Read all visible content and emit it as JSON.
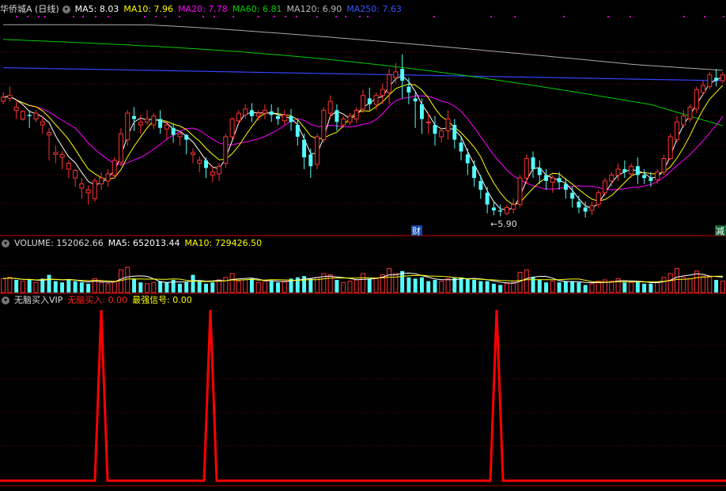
{
  "main_legend": {
    "title": "华侨城A (日线)",
    "ma5": "MA5: 8.03",
    "ma10": "MA10: 7.96",
    "ma20": "MA20: 7.78",
    "ma60": "MA60: 6.81",
    "ma120": "MA120: 6.90",
    "ma250": "MA250: 7.63"
  },
  "low_marker": "←5.90",
  "event_marks": {
    "cai": "财",
    "jian": "减"
  },
  "volume_legend": {
    "label": "VOLUME: 152062.66",
    "ma5": "MA5: 652013.44",
    "ma10": "MA10: 729426.50"
  },
  "indicator_legend": {
    "name": "无脑买入VIP",
    "buy": "无脑买入: 0.00",
    "strong": "最强信号: 0.00"
  },
  "signal_spikes_x": [
    128,
    266,
    628
  ],
  "colors": {
    "up": "#ff3333",
    "down": "#54fcfc",
    "ma5": "#ffffff",
    "ma10": "#ffff00",
    "ma20": "#ff00ff",
    "ma60": "#00cc00",
    "ma120": "#aaaaaa",
    "ma250": "#3333ff",
    "signal": "#ff0000"
  },
  "candles": [
    [
      7.85,
      8.0,
      7.92,
      7.8
    ],
    [
      7.9,
      8.1,
      7.95,
      7.85
    ],
    [
      7.7,
      7.85,
      7.75,
      7.55
    ],
    [
      7.55,
      7.7,
      7.68,
      7.52
    ],
    [
      7.62,
      7.7,
      7.6,
      7.4
    ],
    [
      7.55,
      7.7,
      7.65,
      7.5
    ],
    [
      7.45,
      7.6,
      7.5,
      7.3
    ],
    [
      7.28,
      7.4,
      7.32,
      6.85
    ],
    [
      6.95,
      7.1,
      6.98,
      6.8
    ],
    [
      6.9,
      7.0,
      6.95,
      6.7
    ],
    [
      6.7,
      6.85,
      6.8,
      6.55
    ],
    [
      6.55,
      6.7,
      6.68,
      6.4
    ],
    [
      6.38,
      6.55,
      6.45,
      6.2
    ],
    [
      6.3,
      6.42,
      6.35,
      6.1
    ],
    [
      6.2,
      6.55,
      6.5,
      6.15
    ],
    [
      6.45,
      6.65,
      6.55,
      6.35
    ],
    [
      6.5,
      6.7,
      6.62,
      6.4
    ],
    [
      6.6,
      6.9,
      6.85,
      6.55
    ],
    [
      6.82,
      7.4,
      7.3,
      6.75
    ],
    [
      7.2,
      7.7,
      7.65,
      7.1
    ],
    [
      7.6,
      7.75,
      7.55,
      7.35
    ],
    [
      7.45,
      7.62,
      7.5,
      7.3
    ],
    [
      7.5,
      7.7,
      7.55,
      7.45
    ],
    [
      7.45,
      7.65,
      7.6,
      7.38
    ],
    [
      7.55,
      7.7,
      7.4,
      7.3
    ],
    [
      7.38,
      7.5,
      7.45,
      7.2
    ],
    [
      7.4,
      7.48,
      7.28,
      7.15
    ],
    [
      7.25,
      7.35,
      7.3,
      7.1
    ],
    [
      7.28,
      7.3,
      7.2,
      6.95
    ],
    [
      6.95,
      7.05,
      6.98,
      6.8
    ],
    [
      6.8,
      6.92,
      6.85,
      6.65
    ],
    [
      6.85,
      6.9,
      6.72,
      6.55
    ],
    [
      6.6,
      6.75,
      6.65,
      6.48
    ],
    [
      6.62,
      6.8,
      6.75,
      6.5
    ],
    [
      6.8,
      7.3,
      7.25,
      6.72
    ],
    [
      7.25,
      7.58,
      7.55,
      7.2
    ],
    [
      7.52,
      7.7,
      7.65,
      7.45
    ],
    [
      7.62,
      7.8,
      7.72,
      7.55
    ],
    [
      7.7,
      7.82,
      7.6,
      7.5
    ],
    [
      7.6,
      7.7,
      7.65,
      7.52
    ],
    [
      7.65,
      7.8,
      7.7,
      7.55
    ],
    [
      7.68,
      7.8,
      7.62,
      7.5
    ],
    [
      7.6,
      7.75,
      7.55,
      7.45
    ],
    [
      7.52,
      7.7,
      7.62,
      7.45
    ],
    [
      7.6,
      7.72,
      7.5,
      7.35
    ],
    [
      7.45,
      7.55,
      7.25,
      7.1
    ],
    [
      7.2,
      7.3,
      6.9,
      6.7
    ],
    [
      6.95,
      7.05,
      6.75,
      6.55
    ],
    [
      6.78,
      7.3,
      7.25,
      6.7
    ],
    [
      7.2,
      7.75,
      7.7,
      7.15
    ],
    [
      7.65,
      7.95,
      7.85,
      7.55
    ],
    [
      7.7,
      7.8,
      7.5,
      7.35
    ],
    [
      7.45,
      7.6,
      7.55,
      7.4
    ],
    [
      7.5,
      7.65,
      7.6,
      7.45
    ],
    [
      7.55,
      7.75,
      7.7,
      7.48
    ],
    [
      7.72,
      8.05,
      7.95,
      7.65
    ],
    [
      7.9,
      8.08,
      7.8,
      7.7
    ],
    [
      7.8,
      8.0,
      7.95,
      7.7
    ],
    [
      7.95,
      8.15,
      8.05,
      7.8
    ],
    [
      8.0,
      8.4,
      8.3,
      7.8
    ],
    [
      8.25,
      8.5,
      8.35,
      8.15
    ],
    [
      8.4,
      8.65,
      8.2,
      7.9
    ],
    [
      8.1,
      8.25,
      8.0,
      7.8
    ],
    [
      7.9,
      8.0,
      7.85,
      7.4
    ],
    [
      7.8,
      7.9,
      7.55,
      7.3
    ],
    [
      7.5,
      7.65,
      7.5,
      7.3
    ],
    [
      7.45,
      7.6,
      7.3,
      7.1
    ],
    [
      7.25,
      7.4,
      7.35,
      7.15
    ],
    [
      7.35,
      7.7,
      7.55,
      7.2
    ],
    [
      7.45,
      7.55,
      7.2,
      7.05
    ],
    [
      7.15,
      7.25,
      7.0,
      6.85
    ],
    [
      6.95,
      7.05,
      6.8,
      6.6
    ],
    [
      6.75,
      6.85,
      6.55,
      6.4
    ],
    [
      6.5,
      6.6,
      6.35,
      6.2
    ],
    [
      6.3,
      6.4,
      6.1,
      5.95
    ],
    [
      6.05,
      6.15,
      6.0,
      5.92
    ],
    [
      6.0,
      6.1,
      5.98,
      5.9
    ],
    [
      5.95,
      6.1,
      6.05,
      5.92
    ],
    [
      6.02,
      6.2,
      6.1,
      5.95
    ],
    [
      6.1,
      6.6,
      6.55,
      6.05
    ],
    [
      6.55,
      6.95,
      6.88,
      6.45
    ],
    [
      6.9,
      7.0,
      6.7,
      6.55
    ],
    [
      6.72,
      6.85,
      6.6,
      6.45
    ],
    [
      6.6,
      6.7,
      6.5,
      6.35
    ],
    [
      6.48,
      6.6,
      6.55,
      6.3
    ],
    [
      6.55,
      6.65,
      6.48,
      6.35
    ],
    [
      6.45,
      6.55,
      6.35,
      6.2
    ],
    [
      6.3,
      6.4,
      6.2,
      6.05
    ],
    [
      6.15,
      6.25,
      6.05,
      5.95
    ],
    [
      6.05,
      6.15,
      5.98,
      5.88
    ],
    [
      6.0,
      6.15,
      6.08,
      5.92
    ],
    [
      6.1,
      6.35,
      6.3,
      6.05
    ],
    [
      6.3,
      6.55,
      6.5,
      6.25
    ],
    [
      6.5,
      6.65,
      6.6,
      6.4
    ],
    [
      6.6,
      6.8,
      6.7,
      6.5
    ],
    [
      6.7,
      6.85,
      6.65,
      6.55
    ],
    [
      6.62,
      6.8,
      6.75,
      6.55
    ],
    [
      6.75,
      6.9,
      6.6,
      6.45
    ],
    [
      6.6,
      6.7,
      6.55,
      6.45
    ],
    [
      6.55,
      6.65,
      6.5,
      6.4
    ],
    [
      6.52,
      6.7,
      6.65,
      6.45
    ],
    [
      6.65,
      6.95,
      6.88,
      6.6
    ],
    [
      6.88,
      7.3,
      7.25,
      6.85
    ],
    [
      7.2,
      7.6,
      7.5,
      7.15
    ],
    [
      7.45,
      7.7,
      7.6,
      7.4
    ],
    [
      7.55,
      7.8,
      7.75,
      7.5
    ],
    [
      7.72,
      8.1,
      8.05,
      7.65
    ],
    [
      8.0,
      8.2,
      8.12,
      7.95
    ],
    [
      8.1,
      8.35,
      8.3,
      8.05
    ],
    [
      8.25,
      8.4,
      8.2,
      8.1
    ],
    [
      8.2,
      8.35,
      8.3,
      8.15
    ]
  ],
  "volumes": [
    [
      0.55,
      0
    ],
    [
      0.6,
      0
    ],
    [
      0.5,
      1
    ],
    [
      0.45,
      0
    ],
    [
      0.5,
      1
    ],
    [
      0.4,
      0
    ],
    [
      0.55,
      1
    ],
    [
      0.7,
      1
    ],
    [
      0.45,
      1
    ],
    [
      0.4,
      1
    ],
    [
      0.5,
      1
    ],
    [
      0.45,
      1
    ],
    [
      0.4,
      1
    ],
    [
      0.35,
      1
    ],
    [
      0.55,
      0
    ],
    [
      0.4,
      0
    ],
    [
      0.35,
      0
    ],
    [
      0.45,
      0
    ],
    [
      0.9,
      0
    ],
    [
      1.0,
      0
    ],
    [
      0.55,
      1
    ],
    [
      0.4,
      1
    ],
    [
      0.35,
      0
    ],
    [
      0.4,
      0
    ],
    [
      0.45,
      1
    ],
    [
      0.4,
      1
    ],
    [
      0.5,
      1
    ],
    [
      0.35,
      1
    ],
    [
      0.4,
      1
    ],
    [
      0.7,
      1
    ],
    [
      0.45,
      1
    ],
    [
      0.35,
      1
    ],
    [
      0.4,
      1
    ],
    [
      0.5,
      0
    ],
    [
      0.6,
      0
    ],
    [
      0.75,
      0
    ],
    [
      0.45,
      0
    ],
    [
      0.5,
      0
    ],
    [
      0.55,
      1
    ],
    [
      0.4,
      0
    ],
    [
      0.45,
      0
    ],
    [
      0.45,
      1
    ],
    [
      0.4,
      1
    ],
    [
      0.45,
      0
    ],
    [
      0.55,
      1
    ],
    [
      0.6,
      1
    ],
    [
      0.65,
      1
    ],
    [
      0.55,
      1
    ],
    [
      0.6,
      0
    ],
    [
      0.75,
      0
    ],
    [
      0.7,
      0
    ],
    [
      0.5,
      1
    ],
    [
      0.4,
      0
    ],
    [
      0.45,
      0
    ],
    [
      0.5,
      0
    ],
    [
      0.75,
      0
    ],
    [
      0.55,
      1
    ],
    [
      0.55,
      0
    ],
    [
      0.7,
      0
    ],
    [
      0.95,
      0
    ],
    [
      0.75,
      0
    ],
    [
      0.85,
      1
    ],
    [
      0.6,
      1
    ],
    [
      0.55,
      1
    ],
    [
      0.6,
      1
    ],
    [
      0.45,
      1
    ],
    [
      0.5,
      1
    ],
    [
      0.45,
      0
    ],
    [
      0.55,
      0
    ],
    [
      0.6,
      1
    ],
    [
      0.6,
      1
    ],
    [
      0.55,
      1
    ],
    [
      0.5,
      1
    ],
    [
      0.45,
      1
    ],
    [
      0.45,
      1
    ],
    [
      0.35,
      1
    ],
    [
      0.3,
      1
    ],
    [
      0.35,
      0
    ],
    [
      0.4,
      0
    ],
    [
      0.8,
      0
    ],
    [
      0.9,
      0
    ],
    [
      0.6,
      1
    ],
    [
      0.5,
      1
    ],
    [
      0.4,
      1
    ],
    [
      0.45,
      0
    ],
    [
      0.4,
      1
    ],
    [
      0.45,
      1
    ],
    [
      0.45,
      1
    ],
    [
      0.4,
      1
    ],
    [
      0.3,
      1
    ],
    [
      0.35,
      0
    ],
    [
      0.45,
      0
    ],
    [
      0.5,
      0
    ],
    [
      0.45,
      0
    ],
    [
      0.55,
      0
    ],
    [
      0.4,
      1
    ],
    [
      0.4,
      0
    ],
    [
      0.45,
      1
    ],
    [
      0.35,
      1
    ],
    [
      0.35,
      1
    ],
    [
      0.4,
      0
    ],
    [
      0.6,
      0
    ],
    [
      0.75,
      0
    ],
    [
      0.95,
      0
    ],
    [
      0.6,
      0
    ],
    [
      0.55,
      0
    ],
    [
      0.85,
      0
    ],
    [
      0.65,
      0
    ],
    [
      0.6,
      0
    ],
    [
      0.5,
      1
    ],
    [
      0.45,
      0
    ]
  ]
}
